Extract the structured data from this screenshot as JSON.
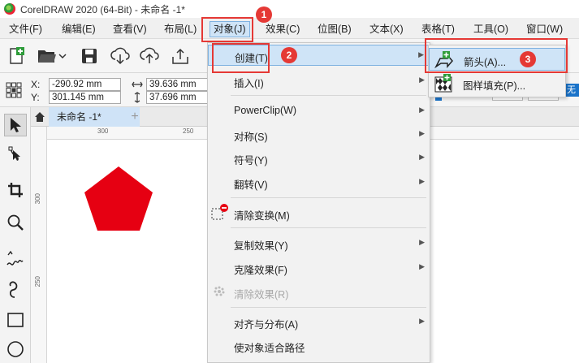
{
  "window": {
    "title": "CorelDRAW 2020 (64-Bit) - 未命名 -1*"
  },
  "menubar": {
    "items": [
      "文件(F)",
      "编辑(E)",
      "查看(V)",
      "布局(L)",
      "对象(J)",
      "效果(C)",
      "位图(B)",
      "文本(X)",
      "表格(T)",
      "工具(O)",
      "窗口(W)"
    ]
  },
  "property_bar": {
    "x_label": "X:",
    "y_label": "Y:",
    "x_value": "-290.92 mm",
    "y_value": "301.145 mm",
    "width_value": "39.636 mm",
    "height_value": "37.696 mm",
    "right_partial_text": "无"
  },
  "document_tab": {
    "label": "未命名 -1*",
    "add_label": "+"
  },
  "rulers": {
    "h_ticks": [
      "300",
      "250"
    ],
    "v_ticks": [
      "300",
      "250"
    ]
  },
  "object_menu": {
    "items": [
      {
        "label": "创建(T)",
        "submenu": true,
        "highlighted": true
      },
      {
        "label": "插入(I)",
        "submenu": true
      },
      {
        "label": "PowerClip(W)",
        "submenu": true
      },
      {
        "label": "对称(S)",
        "submenu": true
      },
      {
        "label": "符号(Y)",
        "submenu": true
      },
      {
        "label": "翻转(V)",
        "submenu": true
      },
      {
        "label": "清除变换(M)",
        "submenu": false
      },
      {
        "label": "复制效果(Y)",
        "submenu": true
      },
      {
        "label": "克隆效果(F)",
        "submenu": true
      },
      {
        "label": "清除效果(R)",
        "submenu": false,
        "disabled": true
      },
      {
        "label": "对齐与分布(A)",
        "submenu": true
      },
      {
        "label": "使对象适合路径",
        "submenu": false
      }
    ]
  },
  "create_submenu": {
    "items": [
      {
        "label": "箭头(A)...",
        "highlighted": true
      },
      {
        "label": "图样填充(P)..."
      }
    ]
  },
  "annotations": {
    "badges": [
      "1",
      "2",
      "3"
    ]
  },
  "colors": {
    "accent": "#e53935",
    "shape_fill": "#e60012",
    "highlight": "#cfe4f7"
  }
}
